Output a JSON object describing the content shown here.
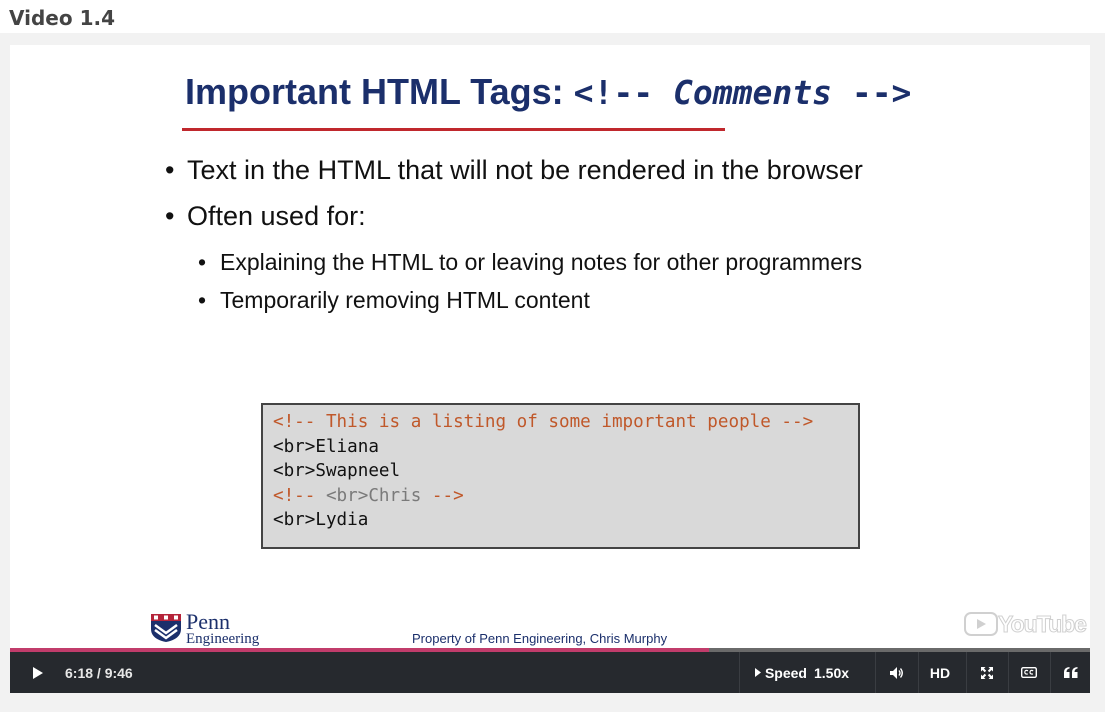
{
  "page": {
    "title": "Video 1.4"
  },
  "slide": {
    "title_text": "Important HTML Tags: ",
    "title_open": "<!-- ",
    "title_word": "Comments",
    "title_close": " -->",
    "bullets": [
      "Text in the HTML that will not be rendered in the browser",
      "Often used for:"
    ],
    "sub_bullets": [
      "Explaining the HTML to or leaving notes for other programmers",
      "Temporarily removing HTML content"
    ],
    "code": {
      "line1": "<!-- This is a listing of some important people -->",
      "line2": "<br>Eliana",
      "line3": "<br>Swapneel",
      "line4_open": "<!-- ",
      "line4_inner": "<br>Chris",
      "line4_close": " -->",
      "line5": "<br>Lydia"
    },
    "logo": {
      "name": "Penn",
      "sub": "Engineering"
    },
    "footer": "Property of Penn Engineering, Chris Murphy"
  },
  "player": {
    "watermark": "YouTube",
    "time": "6:18 / 9:46",
    "progress": 0.647,
    "speed_label": "Speed",
    "speed_value": "1.50x",
    "hd_label": "HD",
    "icons": [
      "play-icon",
      "volume-icon",
      "fullscreen-icon",
      "captions-icon",
      "quote-icon"
    ]
  },
  "colors": {
    "title": "#1b2f6b",
    "rule": "#c0282d",
    "code_comment": "#c0582a",
    "progress": "#c13c6b",
    "control_bar": "#26292e"
  }
}
